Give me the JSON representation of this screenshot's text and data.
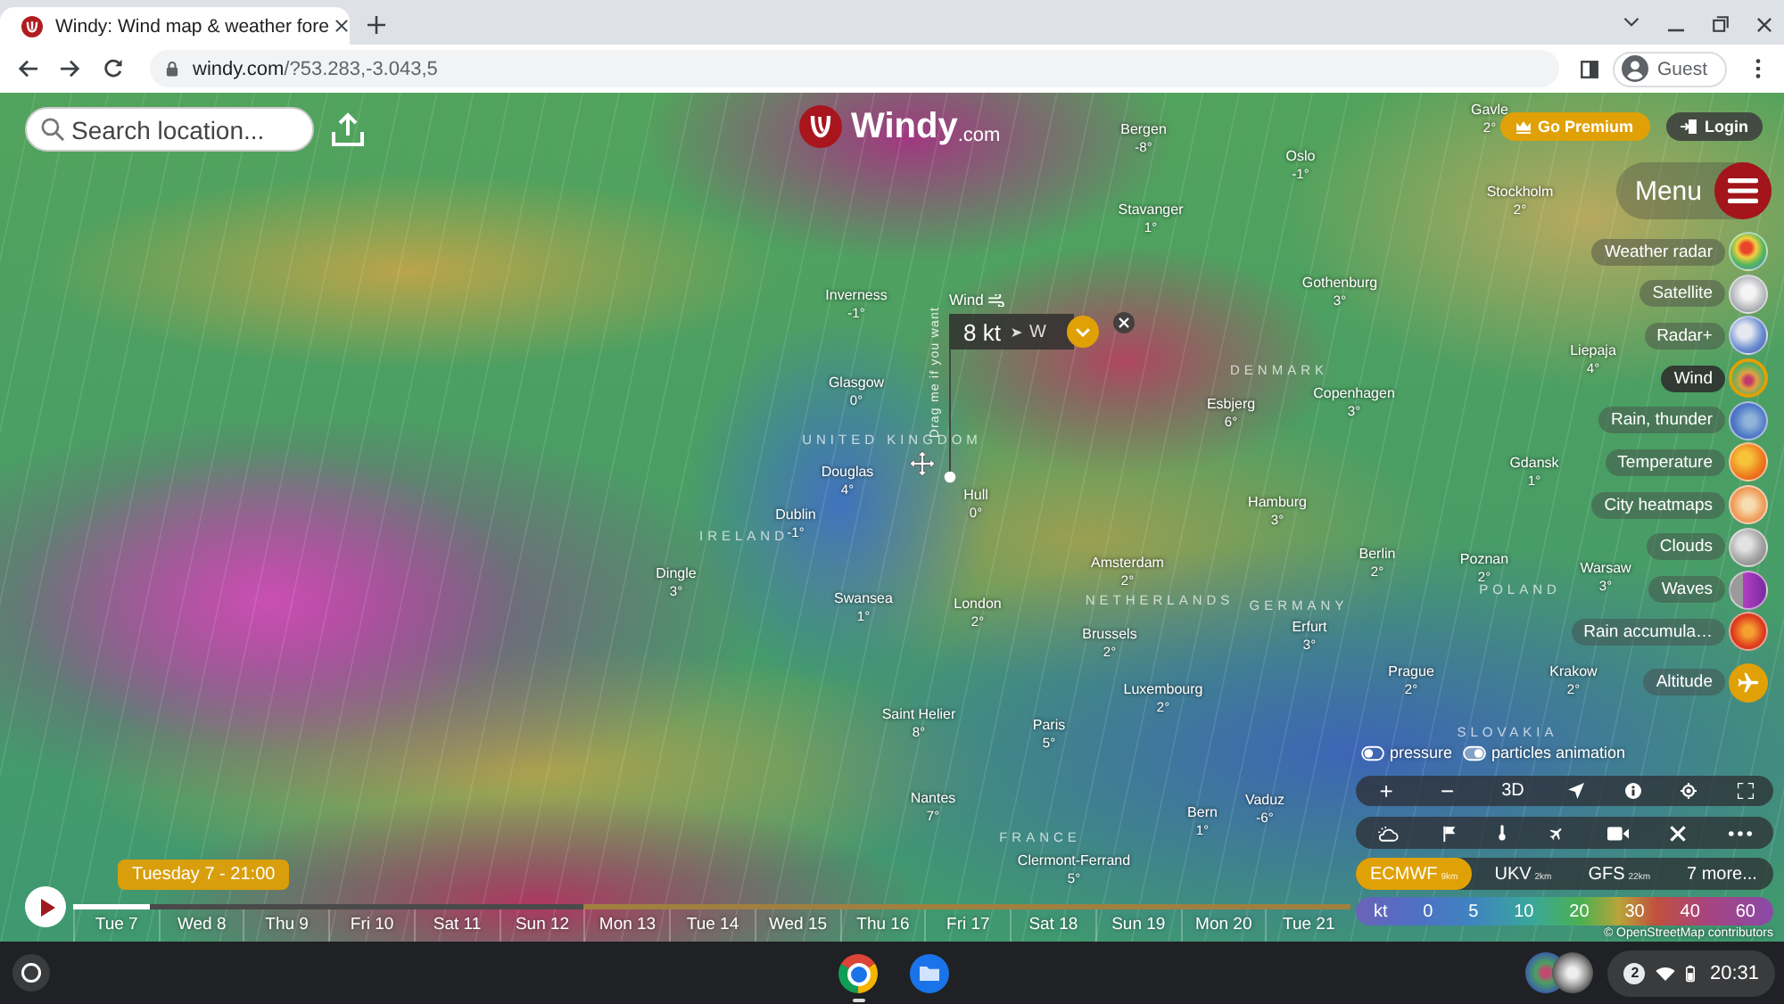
{
  "browser": {
    "tabs": [
      {
        "title": "Windy: Wind map & weather fore",
        "selected": true
      }
    ],
    "address": {
      "host": "windy.com",
      "path": "/?53.283,-3.043,5"
    },
    "profile": "Guest"
  },
  "search": {
    "placeholder": "Search location..."
  },
  "logo": {
    "name": "Windy",
    "suffix": ".com"
  },
  "account": {
    "premium": "Go Premium",
    "login": "Login"
  },
  "menu": "Menu",
  "layers": [
    {
      "label": "Weather radar",
      "kind": "layer",
      "selected": false
    },
    {
      "label": "Satellite",
      "kind": "layer",
      "selected": false
    },
    {
      "label": "Radar+",
      "kind": "layer",
      "selected": false
    },
    {
      "label": "Wind",
      "kind": "layer",
      "selected": true
    },
    {
      "label": "Rain, thunder",
      "kind": "layer",
      "selected": false
    },
    {
      "label": "Temperature",
      "kind": "layer",
      "selected": false
    },
    {
      "label": "City heatmaps",
      "kind": "layer",
      "selected": false
    },
    {
      "label": "Clouds",
      "kind": "layer",
      "selected": false
    },
    {
      "label": "Waves",
      "kind": "layer",
      "selected": false
    },
    {
      "label": "Rain accumula…",
      "kind": "layer",
      "selected": false
    },
    {
      "label": "Altitude",
      "kind": "submenu",
      "selected": false
    }
  ],
  "map": {
    "cities": [
      {
        "name": "Gavle",
        "temp": "2°"
      },
      {
        "name": "Bergen",
        "temp": "-8°"
      },
      {
        "name": "Oslo",
        "temp": "-1°"
      },
      {
        "name": "Stockholm",
        "temp": "2°"
      },
      {
        "name": "Stavanger",
        "temp": "1°"
      },
      {
        "name": "Inverness",
        "temp": "-1°"
      },
      {
        "name": "Gothenburg",
        "temp": "3°"
      },
      {
        "name": "Liepaja",
        "temp": "4°"
      },
      {
        "name": "Glasgow",
        "temp": "0°"
      },
      {
        "name": "Esbjerg",
        "temp": "6°"
      },
      {
        "name": "Copenhagen",
        "temp": "3°"
      },
      {
        "name": "Douglas",
        "temp": "4°"
      },
      {
        "name": "Gdansk",
        "temp": "1°"
      },
      {
        "name": "Dublin",
        "temp": "-1°"
      },
      {
        "name": "Hull",
        "temp": "0°"
      },
      {
        "name": "Hamburg",
        "temp": "3°"
      },
      {
        "name": "Dingle",
        "temp": "3°"
      },
      {
        "name": "Amsterdam",
        "temp": "2°"
      },
      {
        "name": "Berlin",
        "temp": "2°"
      },
      {
        "name": "Poznan",
        "temp": "2°"
      },
      {
        "name": "Warsaw",
        "temp": "3°"
      },
      {
        "name": "Swansea",
        "temp": "1°"
      },
      {
        "name": "London",
        "temp": "2°"
      },
      {
        "name": "Brussels",
        "temp": "2°"
      },
      {
        "name": "Erfurt",
        "temp": "3°"
      },
      {
        "name": "Luxembourg",
        "temp": "2°"
      },
      {
        "name": "Prague",
        "temp": "2°"
      },
      {
        "name": "Krakow",
        "temp": "2°"
      },
      {
        "name": "Saint Helier",
        "temp": "8°"
      },
      {
        "name": "Paris",
        "temp": "5°"
      },
      {
        "name": "Nantes",
        "temp": "7°"
      },
      {
        "name": "Bern",
        "temp": "1°"
      },
      {
        "name": "Vaduz",
        "temp": "-6°"
      },
      {
        "name": "Clermont-Ferrand",
        "temp": "5°"
      }
    ],
    "regions": [
      "DENMARK",
      "UNITED KINGDOM",
      "IRELAND",
      "NETHERLANDS",
      "GERMANY",
      "POLAND",
      "SLOVAKIA",
      "FRANCE"
    ]
  },
  "picker": {
    "label": "Wind",
    "value": "8 kt",
    "direction": "W",
    "hint": "Drag me if you want"
  },
  "overlays": [
    {
      "label": "pressure",
      "on": false
    },
    {
      "label": "particles animation",
      "on": true
    }
  ],
  "map_tools": {
    "zoom_in": "+",
    "zoom_out": "−",
    "view_3d": "3D"
  },
  "models": [
    {
      "name": "ECMWF",
      "resolution": "9km",
      "selected": true
    },
    {
      "name": "UKV",
      "resolution": "2km",
      "selected": false
    },
    {
      "name": "GFS",
      "resolution": "22km",
      "selected": false
    }
  ],
  "more_models": "7 more...",
  "legend": {
    "unit": "kt",
    "stops": [
      "0",
      "5",
      "10",
      "20",
      "30",
      "40",
      "60"
    ]
  },
  "attribution": "© OpenStreetMap contributors",
  "timeline": {
    "time": "Tuesday 7 - 21:00",
    "level": 0.06,
    "days": [
      {
        "label": "Tue 7",
        "premium": false
      },
      {
        "label": "Wed 8",
        "premium": false
      },
      {
        "label": "Thu 9",
        "premium": false
      },
      {
        "label": "Fri 10",
        "premium": false
      },
      {
        "label": "Sat 11",
        "premium": false
      },
      {
        "label": "Sun 12",
        "premium": false
      },
      {
        "label": "Mon 13",
        "premium": true
      },
      {
        "label": "Tue 14",
        "premium": true
      },
      {
        "label": "Wed 15",
        "premium": true
      },
      {
        "label": "Thu 16",
        "premium": true
      },
      {
        "label": "Fri 17",
        "premium": true
      },
      {
        "label": "Sat 18",
        "premium": true
      },
      {
        "label": "Sun 19",
        "premium": true
      },
      {
        "label": "Mon 20",
        "premium": true
      },
      {
        "label": "Tue 21",
        "premium": true
      }
    ]
  },
  "taskbar": {
    "notifications": "2",
    "clock": "20:31"
  }
}
